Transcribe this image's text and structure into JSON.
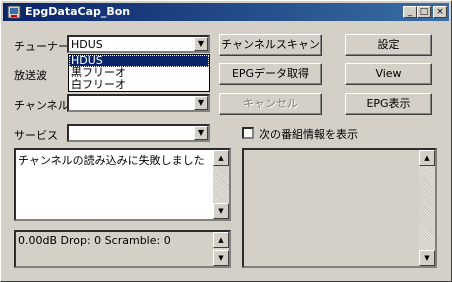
{
  "window": {
    "title": "EpgDataCap_Bon"
  },
  "titlebar_buttons": {
    "minimize": "_",
    "maximize": "□",
    "close": "×"
  },
  "labels": {
    "tuner": "チューナー",
    "broadcast": "放送波",
    "channel": "チャンネル",
    "service": "サービス"
  },
  "tuner_combo": {
    "value": "HDUS",
    "options": [
      "HDUS",
      "黒フリーオ",
      "白フリーオ"
    ],
    "selected_index": 0
  },
  "buttons": {
    "channel_scan": "チャンネルスキャン",
    "settings": "設定",
    "epg_get": "EPGデータ取得",
    "view": "View",
    "cancel": "キャンセル",
    "epg_show": "EPG表示"
  },
  "checkbox": {
    "label": "次の番組情報を表示",
    "checked": false
  },
  "log": {
    "text": "チャンネルの読み込みに失敗しました"
  },
  "status": {
    "text": "0.00dB Drop: 0 Scramble: 0"
  },
  "icons": {
    "dropdown": "▼",
    "scroll_up": "▲",
    "scroll_down": "▼"
  }
}
